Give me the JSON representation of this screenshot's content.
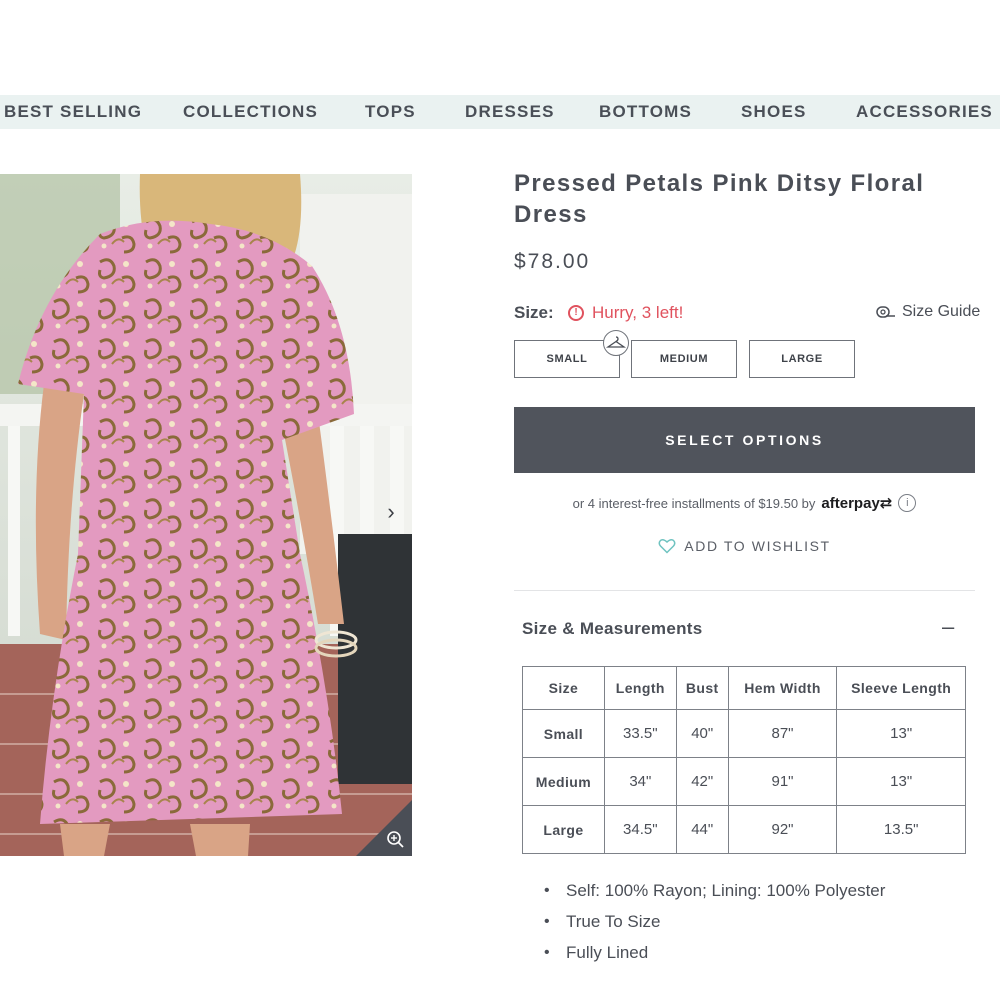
{
  "nav": {
    "items": [
      "BEST SELLING",
      "COLLECTIONS",
      "TOPS",
      "DRESSES",
      "BOTTOMS",
      "SHOES",
      "ACCESSORIES"
    ]
  },
  "gallery": {
    "next_icon": "chevron-right-icon",
    "zoom_icon": "zoom-in-icon"
  },
  "product": {
    "title": "Pressed Petals Pink Ditsy Floral Dress",
    "price": "$78.00"
  },
  "size": {
    "label": "Size:",
    "stock_alert": "Hurry, 3 left!",
    "alert_color": "#e0525e",
    "guide_label": "Size Guide",
    "options": [
      "SMALL",
      "MEDIUM",
      "LARGE"
    ]
  },
  "cta": {
    "select_label": "SELECT OPTIONS",
    "button_color": "#50545c"
  },
  "afterpay": {
    "text": "or 4 interest-free installments of $19.50 by",
    "brand": "afterpay"
  },
  "wishlist": {
    "label": "ADD TO WISHLIST"
  },
  "measurements": {
    "title": "Size & Measurements",
    "toggle": "–",
    "headers": [
      "Size",
      "Length",
      "Bust",
      "Hem Width",
      "Sleeve Length"
    ],
    "rows": [
      [
        "Small",
        "33.5\"",
        "40\"",
        "87\"",
        "13\""
      ],
      [
        "Medium",
        "34\"",
        "42\"",
        "91\"",
        "13\""
      ],
      [
        "Large",
        "34.5\"",
        "44\"",
        "92\"",
        "13.5\""
      ]
    ]
  },
  "features": [
    "Self: 100% Rayon; Lining: 100% Polyester",
    "True To Size",
    "Fully Lined"
  ]
}
